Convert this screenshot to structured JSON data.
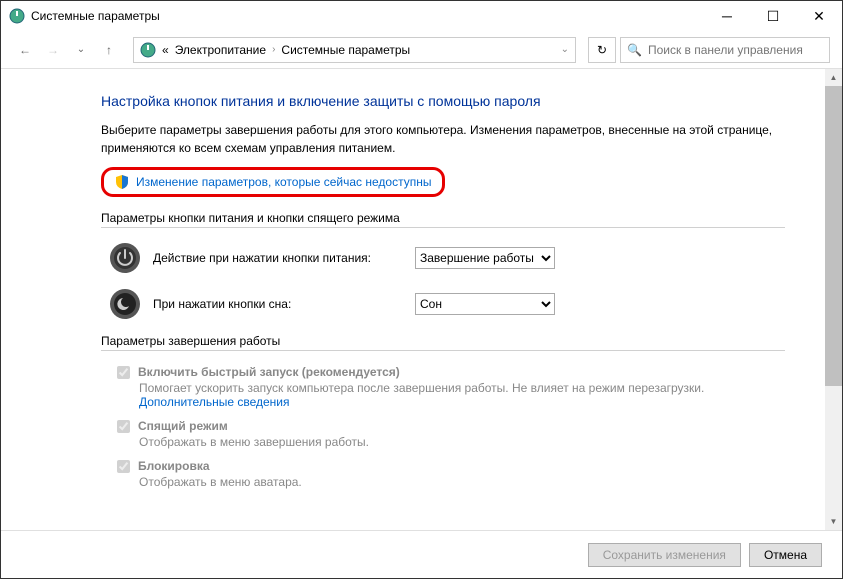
{
  "window": {
    "title": "Системные параметры"
  },
  "breadcrumbs": {
    "level1": "Электропитание",
    "level2": "Системные параметры"
  },
  "search": {
    "placeholder": "Поиск в панели управления"
  },
  "heading": "Настройка кнопок питания и включение защиты с помощью пароля",
  "intro": "Выберите параметры завершения работы для этого компьютера. Изменения параметров, внесенные на этой странице, применяются ко всем схемам управления питанием.",
  "change_link": "Изменение параметров, которые сейчас недоступны",
  "section_buttons": "Параметры кнопки питания и кнопки спящего режима",
  "power_button": {
    "label": "Действие при нажатии кнопки питания:",
    "value": "Завершение работы"
  },
  "sleep_button": {
    "label": "При нажатии кнопки сна:",
    "value": "Сон"
  },
  "section_shutdown": "Параметры завершения работы",
  "cb_fastboot": {
    "label": "Включить быстрый запуск (рекомендуется)",
    "desc": "Помогает ускорить запуск компьютера после завершения работы. Не влияет на режим перезагрузки.",
    "more": "Дополнительные сведения"
  },
  "cb_sleep": {
    "label": "Спящий режим",
    "desc": "Отображать в меню завершения работы."
  },
  "cb_lock": {
    "label": "Блокировка",
    "desc": "Отображать в меню аватара."
  },
  "footer": {
    "save": "Сохранить изменения",
    "cancel": "Отмена"
  }
}
